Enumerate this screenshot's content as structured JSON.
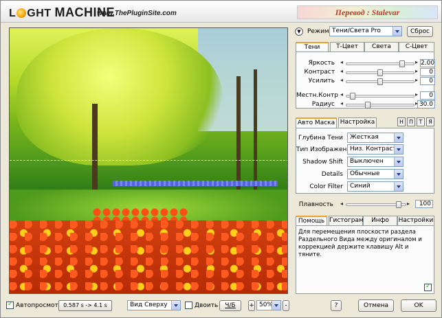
{
  "header": {
    "logo_light": "L",
    "logo_ght": "GHT",
    "logo_machine": "MACHINE",
    "site": "www.ThePluginSite.com",
    "translator": "Перевод : Stalevar"
  },
  "mode": {
    "label": "Режим",
    "value": "Тени/Света Pro",
    "reset": "Сброс"
  },
  "top_tabs": [
    "Тени",
    "Т-Цвет",
    "Света",
    "С-Цвет"
  ],
  "shadows": {
    "brightness": {
      "label": "Яркость",
      "value": "2.00",
      "fraction": 0.85
    },
    "contrast": {
      "label": "Контраст",
      "value": "0",
      "fraction": 0.5
    },
    "boost": {
      "label": "Усилить",
      "value": "0",
      "fraction": 0.5
    },
    "local_contrast": {
      "label": "Местн.Контр",
      "value": "0",
      "fraction": 0.05
    },
    "radius": {
      "label": "Радиус",
      "value": "30.0",
      "fraction": 0.3
    }
  },
  "mask_tabs": [
    "Авто Маска",
    "Настройка"
  ],
  "mask_buttons": [
    "Н",
    "П",
    "Т",
    "Я"
  ],
  "mask": {
    "shadow_depth": {
      "label": "Глубина Тени",
      "value": "Жесткая"
    },
    "image_type": {
      "label": "Тип Изображен",
      "value": "Низ. Контрастн"
    },
    "shadow_shift": {
      "label": "Shadow Shift",
      "value": "Выключен"
    },
    "details": {
      "label": "Details",
      "value": "Обычные"
    },
    "color_filter": {
      "label": "Color Filter",
      "value": "Синий"
    }
  },
  "smoothness": {
    "label": "Плавность",
    "value": "100",
    "fraction": 0.92
  },
  "help_tabs": [
    "Помощь",
    "Гистограм",
    "Инфо",
    "Настройки"
  ],
  "help_text": "Для перемещения плоскости раздела Раздельного Вида между оригиналом и коррекцией держите клавишу Alt и тяните.",
  "bottom": {
    "autopreview": "Автопросмотр",
    "timing": "0.587 s -> 4.1 s",
    "view": "Вид Сверху",
    "twain": "Двоить",
    "bw": "Ч/Б",
    "zoom_minus": "-",
    "zoom_plus": "+",
    "zoom": "50%",
    "help": "?",
    "cancel": "Отмена",
    "ok": "OK"
  }
}
